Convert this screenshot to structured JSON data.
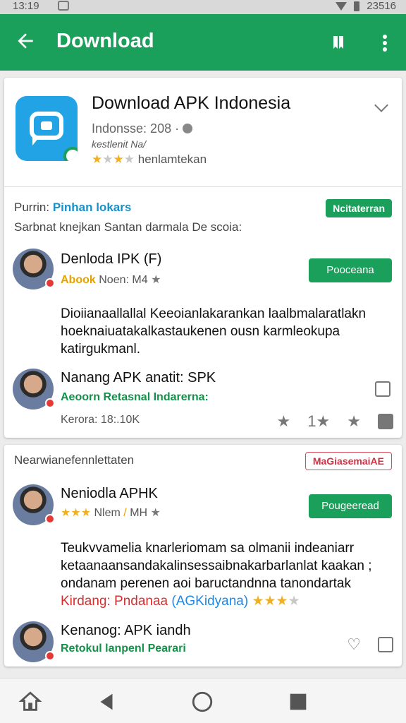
{
  "status_bar": {
    "time": "13:19",
    "right_text": "23516"
  },
  "app_bar": {
    "title": "Download",
    "icons": [
      "back-arrow-icon",
      "bookmark-icon",
      "more-vert-icon"
    ]
  },
  "app_header": {
    "name": "Download APK Indonesia",
    "subtitle": "Indonsse: 208 ·",
    "developer": "kestlenit Na/",
    "rating_text": "henlamtekan",
    "icon": "chat-bubble-icon"
  },
  "section1": {
    "label_prefix": "Purrin:",
    "label_accent": "Pinhan lokars",
    "label_line2": "Sarbnat knejkan Santan darmala De scoia:",
    "badge": "Ncitaterran"
  },
  "posts": [
    {
      "name": "Denloda IPK (F)",
      "meta_accent": "Abook",
      "meta_rest": "Noen: M4",
      "button": "Pooceana",
      "body": "Dioiianaallallal Keeoianlakarankan laalbmalaratlakn hoeknaiuatakalkastaukenen ousn karmleokupa katirgukmanl.",
      "footer_title": "Nanang APK anatit: SPK",
      "footer_tag_a": "Aeoorn Retasnal",
      "footer_tag_b": "Indarerna:",
      "footer_meta": "Kerora: 18:.10K",
      "footer_count": "1"
    },
    {
      "section_label": "Nearwianefennlettaten",
      "section_badge": "MaGiasemaiAE",
      "name": "Neniodla APHK",
      "meta_rest": "Nlem",
      "meta_extra": "MH",
      "button": "Pougeeread",
      "body": "Teukvvamelia knarleriomam sa olmanii indeaniarr ketaanaansandakalinsessaibnakarbarlanlat kaakan ; ondanam perenen aoi baructandnna tanondartak",
      "body_red": "Kirdang: Pndanaa",
      "body_blue": "(AGKidyana)",
      "footer_title": "Kenanog: APK iandh",
      "footer_tag_a": "Retokul lanpenl",
      "footer_tag_b": "Pearari"
    }
  ],
  "nav_bar": {
    "icons": [
      "home-icon",
      "back-triangle-icon",
      "home-circle-icon",
      "recents-square-icon"
    ]
  },
  "colors": {
    "primary": "#1aa05a",
    "accent_blue": "#1990c8",
    "star": "#f2b01e",
    "badge_alert": "#d43044"
  }
}
